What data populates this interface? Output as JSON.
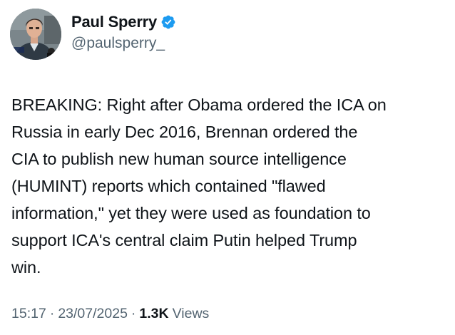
{
  "author": {
    "display_name": "Paul Sperry",
    "handle": "@paulsperry_",
    "verified": true,
    "verified_color": "#1d9bf0",
    "avatar_caption": "Sperry"
  },
  "tweet": {
    "text": "BREAKING: Right after Obama ordered the ICA on\nRussia in early Dec 2016, Brennan ordered the\nCIA to publish new human source intelligence\n(HUMINT) reports which contained \"flawed\ninformation,\" yet they were used as foundation to\nsupport ICA's central claim Putin helped Trump\nwin."
  },
  "meta": {
    "time": "15:17",
    "separator": "·",
    "date": "23/07/2025",
    "views_count": "1.3K",
    "views_label": "Views"
  }
}
